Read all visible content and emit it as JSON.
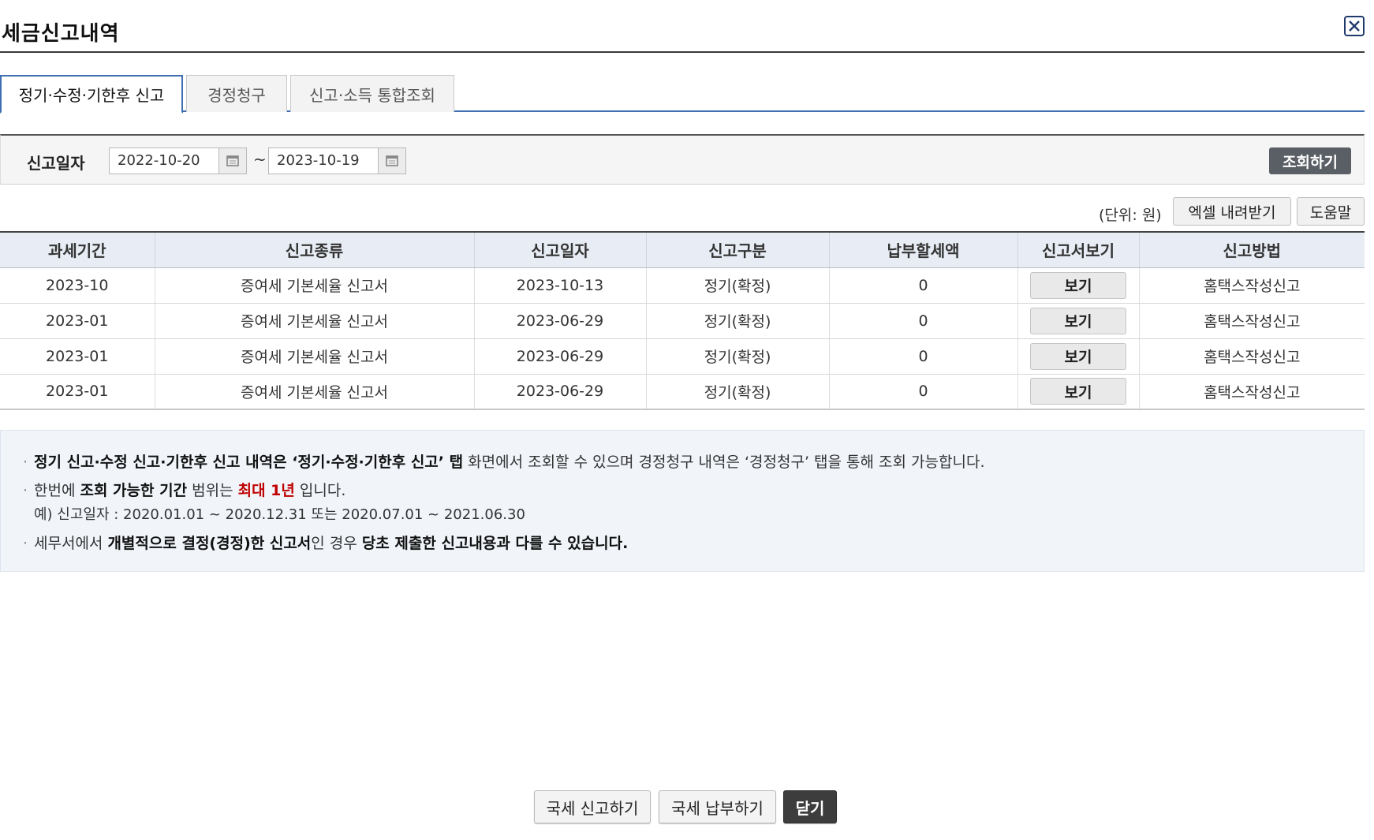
{
  "window": {
    "title": "세금신고내역"
  },
  "tabs": [
    {
      "label": "정기·수정·기한후 신고"
    },
    {
      "label": "경정청구"
    },
    {
      "label": "신고·소득 통합조회"
    }
  ],
  "search": {
    "label": "신고일자",
    "start_date": "2022-10-20",
    "end_date": "2023-10-19",
    "separator": "~",
    "query_button": "조회하기"
  },
  "toolbar": {
    "unit": "(단위: 원)",
    "excel_button": "엑셀 내려받기",
    "help_button": "도움말"
  },
  "table": {
    "headers": [
      "과세기간",
      "신고종류",
      "신고일자",
      "신고구분",
      "납부할세액",
      "신고서보기",
      "신고방법"
    ],
    "rows": [
      {
        "period": "2023-10",
        "type": "증여세 기본세율 신고서",
        "date": "2023-10-13",
        "category": "정기(확정)",
        "tax": "0",
        "view": "보기",
        "method": "홈택스작성신고"
      },
      {
        "period": "2023-01",
        "type": "증여세 기본세율 신고서",
        "date": "2023-06-29",
        "category": "정기(확정)",
        "tax": "0",
        "view": "보기",
        "method": "홈택스작성신고"
      },
      {
        "period": "2023-01",
        "type": "증여세 기본세율 신고서",
        "date": "2023-06-29",
        "category": "정기(확정)",
        "tax": "0",
        "view": "보기",
        "method": "홈택스작성신고"
      },
      {
        "period": "2023-01",
        "type": "증여세 기본세율 신고서",
        "date": "2023-06-29",
        "category": "정기(확정)",
        "tax": "0",
        "view": "보기",
        "method": "홈택스작성신고"
      }
    ]
  },
  "notice": {
    "line1_bold": "정기 신고·수정 신고·기한후 신고 내역은 ‘정기·수정·기한후 신고’ 탭",
    "line1_rest": " 화면에서 조회할 수 있으며 경정청구 내역은  ‘경정청구’ 탭을 통해 조회 가능합니다.",
    "line2_a": "한번에 ",
    "line2_bold": "조회 가능한 기간",
    "line2_b": " 범위는 ",
    "line2_red": "최대 1년",
    "line2_c": " 입니다.",
    "line3": "예) 신고일자 : 2020.01.01 ~ 2020.12.31 또는 2020.07.01 ~ 2021.06.30",
    "line4_a": "세무서에서 ",
    "line4_bold1": "개별적으로 결정(경정)한 신고서",
    "line4_b": "인 경우 ",
    "line4_bold2": "당초 제출한 신고내용과 다를 수 있습니다."
  },
  "footer": {
    "file_button": "국세 신고하기",
    "pay_button": "국세 납부하기",
    "close_button": "닫기"
  },
  "colors": {
    "accent": "#3f6fb3",
    "header_bg": "#e8edf5",
    "notice_bg": "#f1f5fa",
    "highlight_red": "#c00000"
  }
}
